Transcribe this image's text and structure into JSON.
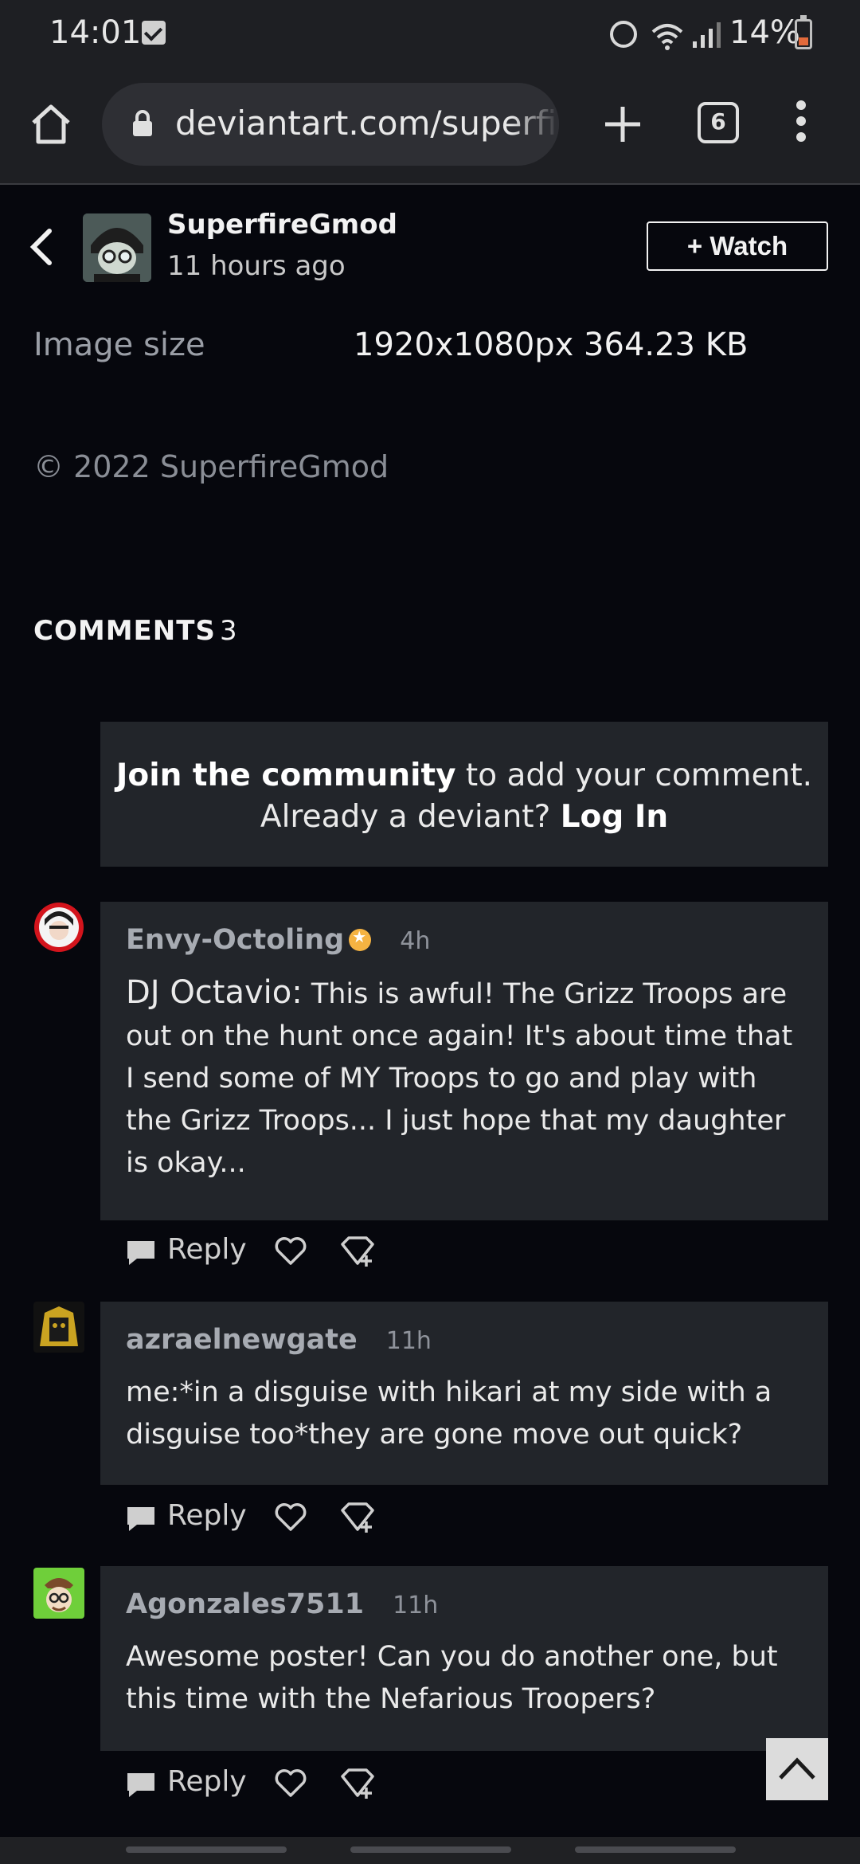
{
  "status_bar": {
    "time": "14:01",
    "battery": "14%"
  },
  "browser": {
    "url": "deviantart.com/superfi",
    "tab_count": "6"
  },
  "header": {
    "author": "SuperfireGmod",
    "posted": "11 hours ago",
    "watch_label": "+ Watch"
  },
  "details": {
    "image_size_label": "Image size",
    "image_size_value": "1920x1080px 364.23 KB",
    "copyright": "© 2022 SuperfireGmod"
  },
  "comments_section": {
    "title": "COMMENTS",
    "count": "3",
    "join_bold": "Join the community",
    "join_text": " to add your comment. Already a deviant? ",
    "login": "Log In"
  },
  "comments": [
    {
      "user": "Envy-Octoling",
      "time": "4h",
      "speaker": "DJ Octavio:",
      "text": " This is awful! The Grizz Troops are out on the hunt once again! It's about time that I send some of MY Troops to go and play with the Grizz Troops... I just hope that my daughter is okay..."
    },
    {
      "user": "azraelnewgate",
      "time": "11h",
      "text": "me:*in a disguise with hikari at my side with a disguise too*they are gone move out quick?"
    },
    {
      "user": "Agonzales7511",
      "time": "11h",
      "text": "Awesome poster! Can you do another one, but this time with the Nefarious Troopers?"
    }
  ],
  "actions": {
    "reply_label": "Reply"
  },
  "icons": [
    "home-icon",
    "lock-icon",
    "plus-icon",
    "tabs-icon",
    "more-icon",
    "back-icon",
    "reply-icon",
    "heart-icon",
    "award-icon",
    "chevron-up-icon"
  ],
  "colors": {
    "background": "#06070d",
    "card": "#22252a",
    "badge": "#f5b342"
  }
}
